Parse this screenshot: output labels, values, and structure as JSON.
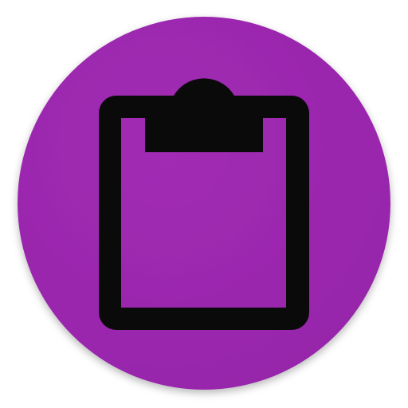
{
  "icon": {
    "name": "clipboard-icon",
    "colors": {
      "background_circle": "#9C27B0",
      "glyph": "#0A0A0A",
      "page": "#ffffff"
    }
  }
}
